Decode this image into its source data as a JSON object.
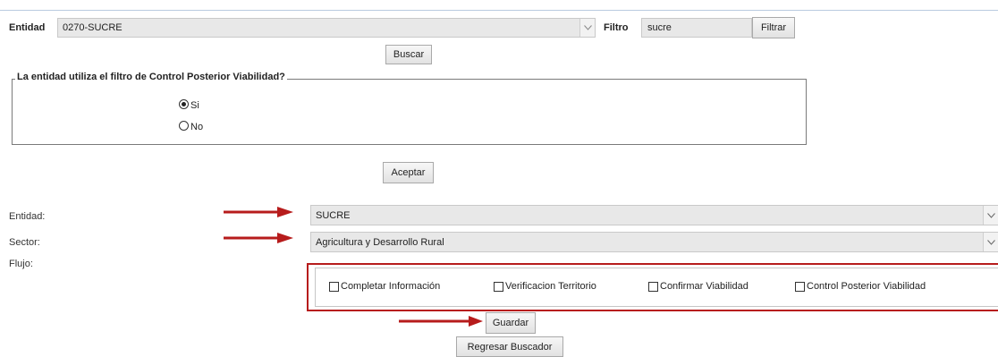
{
  "header": {
    "entidad_label": "Entidad",
    "entidad_value": "0270-SUCRE",
    "filtro_label": "Filtro",
    "filtro_value": "sucre",
    "filtrar_button": "Filtrar",
    "buscar_button": "Buscar"
  },
  "control_posterior": {
    "legend": "La entidad utiliza el filtro de Control Posterior Viabilidad?",
    "options": [
      {
        "label": "Si",
        "selected": true
      },
      {
        "label": "No",
        "selected": false
      }
    ],
    "aceptar_button": "Aceptar"
  },
  "form": {
    "entidad_label": "Entidad:",
    "entidad_value": "SUCRE",
    "sector_label": "Sector:",
    "sector_value": "Agricultura y Desarrollo Rural",
    "flujo_label": "Flujo:",
    "flujo_options": [
      {
        "label": "Completar Información",
        "checked": false
      },
      {
        "label": "Verificacion Territorio",
        "checked": false
      },
      {
        "label": "Confirmar Viabilidad",
        "checked": false
      },
      {
        "label": "Control Posterior Viabilidad",
        "checked": false
      }
    ],
    "guardar_button": "Guardar",
    "regresar_button": "Regresar Buscador"
  },
  "colors": {
    "annotation_red": "#b71c1c",
    "field_bg": "#e8e8e8"
  },
  "icons": {
    "dropdown": "chevron-down-icon",
    "annotation": "red-arrow-icon"
  }
}
